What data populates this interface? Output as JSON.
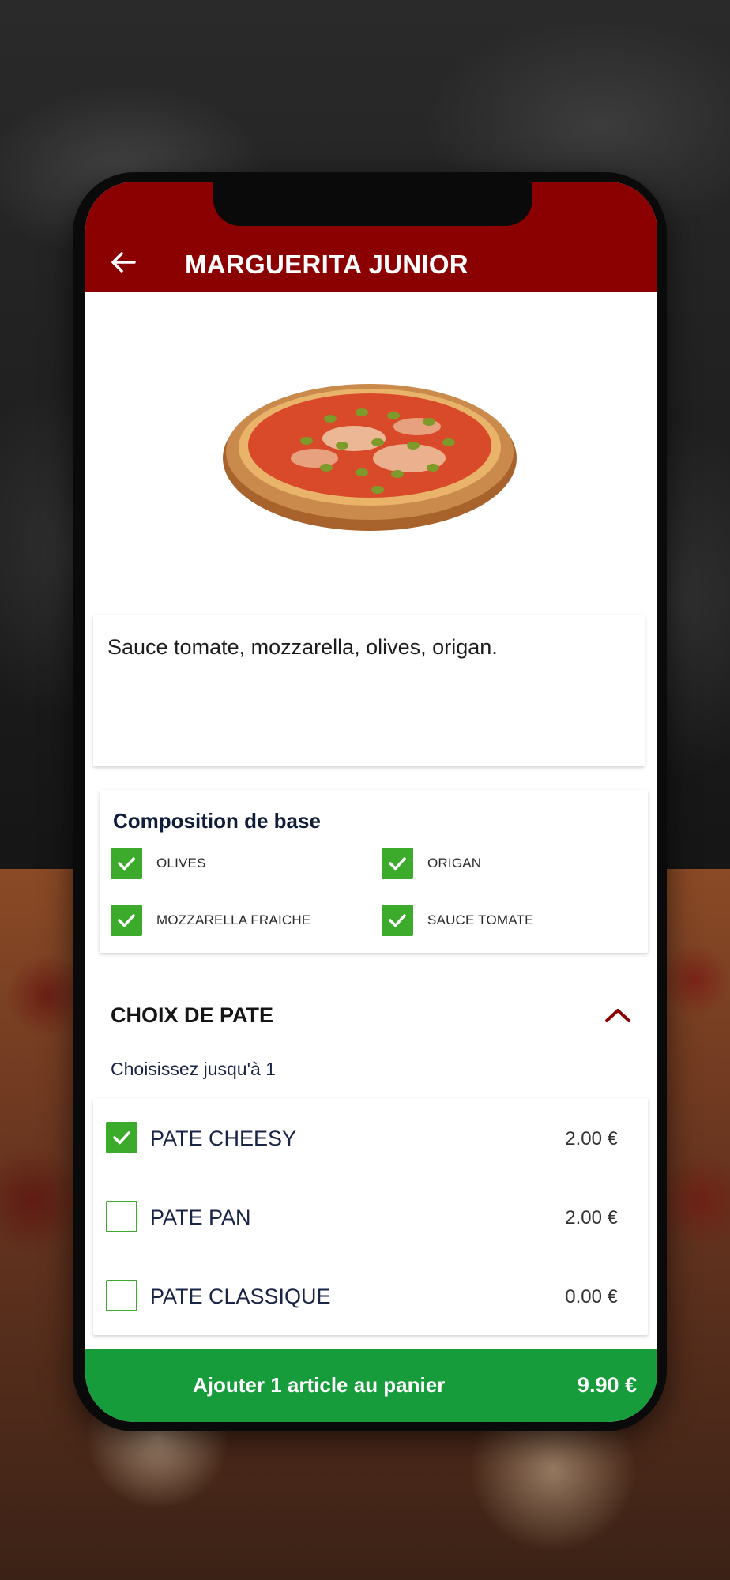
{
  "header": {
    "title": "MARGUERITA JUNIOR"
  },
  "product": {
    "image_alt": "pizza-image",
    "description": "Sauce tomate, mozzarella, olives, origan."
  },
  "base_composition": {
    "title": "Composition de base",
    "items": [
      {
        "label": "OLIVES",
        "checked": true
      },
      {
        "label": "ORIGAN",
        "checked": true
      },
      {
        "label": "MOZZARELLA FRAICHE",
        "checked": true
      },
      {
        "label": "SAUCE TOMATE",
        "checked": true
      }
    ]
  },
  "dough_choice": {
    "title": "CHOIX DE PATE",
    "subtitle": "Choisissez jusqu'à 1",
    "options": [
      {
        "label": "PATE CHEESY",
        "price": "2.00 €",
        "checked": true
      },
      {
        "label": "PATE PAN",
        "price": "2.00 €",
        "checked": false
      },
      {
        "label": "PATE CLASSIQUE",
        "price": "0.00 €",
        "checked": false
      }
    ]
  },
  "cart": {
    "label": "Ajouter 1 article au panier",
    "total": "9.90 €"
  },
  "colors": {
    "header_bg": "#8b0000",
    "check_green": "#3cab2c",
    "cart_bg": "#169c3a",
    "text_navy": "#1a2447"
  }
}
